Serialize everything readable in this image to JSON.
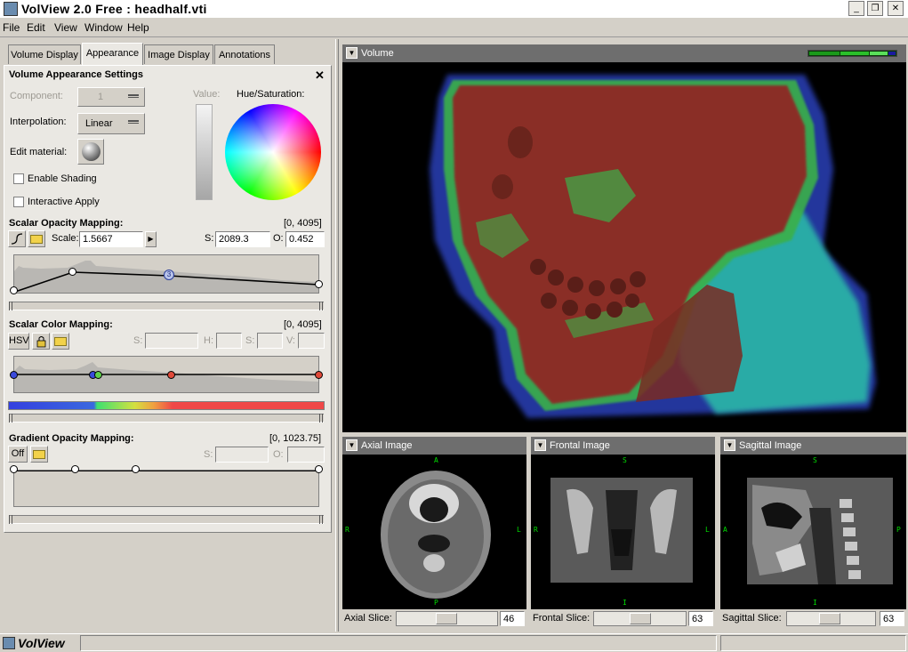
{
  "window": {
    "title": "VolView 2.0 Free : headhalf.vti",
    "controls": {
      "minimize": "_",
      "maximize": "❐",
      "close": "✕"
    }
  },
  "menu": [
    "File",
    "Edit",
    "View",
    "Window",
    "Help"
  ],
  "tabs": [
    "Volume Display",
    "Appearance",
    "Image Display",
    "Annotations"
  ],
  "active_tab": "Appearance",
  "appearance": {
    "section_title": "Volume Appearance Settings",
    "close_glyph": "✕",
    "component_label": "Component:",
    "component_value": "1",
    "interpolation_label": "Interpolation:",
    "interpolation_value": "Linear",
    "edit_material_label": "Edit material:",
    "value_label": "Value:",
    "hue_sat_label": "Hue/Saturation:",
    "enable_shading": {
      "label": "Enable Shading",
      "checked": false
    },
    "interactive_apply": {
      "label": "Interactive Apply",
      "checked": false
    }
  },
  "scalar_opacity": {
    "title": "Scalar Opacity Mapping:",
    "range": "[0, 4095]",
    "scale_label": "Scale:",
    "scale_value": "1.5667",
    "s_label": "S:",
    "s_value": "2089.3",
    "o_label": "O:",
    "o_value": "0.452",
    "point_label": "3"
  },
  "scalar_color": {
    "title": "Scalar Color Mapping:",
    "range": "[0, 4095]",
    "hsv_label": "HSV",
    "s_label": "S:",
    "h_label": "H:",
    "s2_label": "S:",
    "v_label": "V:"
  },
  "gradient_opacity": {
    "title": "Gradient Opacity Mapping:",
    "range": "[0, 1023.75]",
    "off_label": "Off",
    "s_label": "S:",
    "o_label": "O:"
  },
  "views": {
    "volume": {
      "title": "Volume"
    },
    "axial": {
      "title": "Axial Image",
      "slice_label": "Axial Slice:",
      "slice_value": "46",
      "top": "A",
      "bottom": "P",
      "left": "R",
      "right": "L"
    },
    "frontal": {
      "title": "Frontal Image",
      "slice_label": "Frontal Slice:",
      "slice_value": "63",
      "top": "S",
      "bottom": "I",
      "left": "R",
      "right": "L"
    },
    "sagittal": {
      "title": "Sagittal Image",
      "slice_label": "Sagittal Slice:",
      "slice_value": "63",
      "top": "S",
      "bottom": "I",
      "left": "A",
      "right": "P"
    }
  },
  "statusbar": {
    "app_label": "VolView"
  },
  "colors": {
    "tissue_red": "#8a2f25",
    "tissue_green": "#3ab04a",
    "tissue_cyan": "#29b8a8",
    "tissue_blue": "#2a3fb8",
    "header_gray": "#6e6e6e"
  }
}
